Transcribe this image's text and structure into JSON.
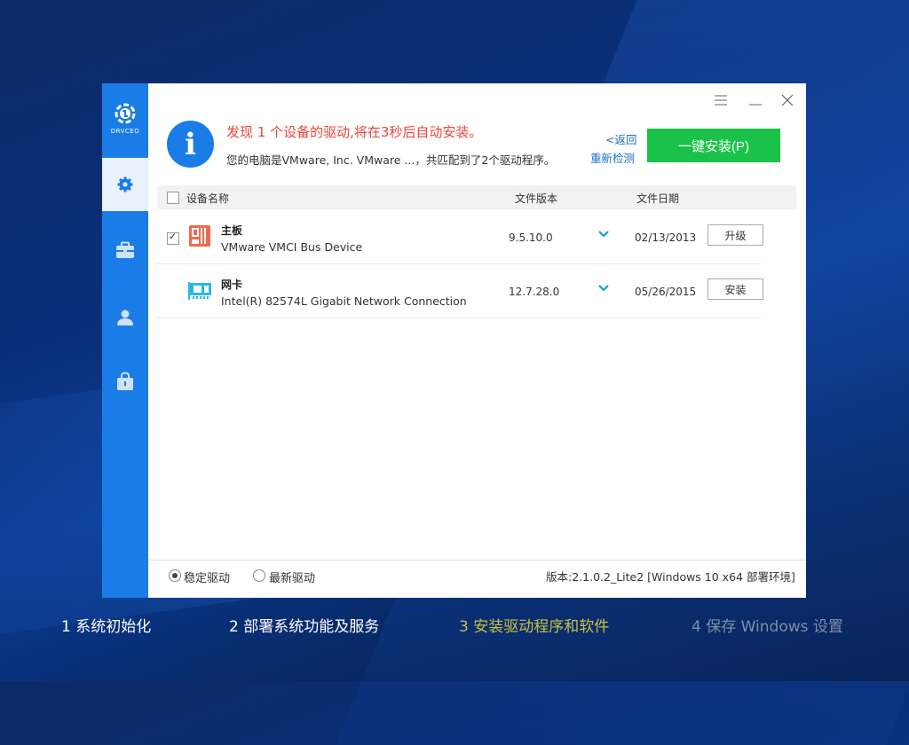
{
  "app": {
    "logo_text": "DRVCEO"
  },
  "sidebar": {
    "items": [
      {
        "icon": "gear-icon",
        "active": true
      },
      {
        "icon": "toolbox-icon",
        "active": false
      },
      {
        "icon": "user-icon",
        "active": false
      },
      {
        "icon": "bag-icon",
        "active": false
      }
    ]
  },
  "window_controls": {
    "menu": "☰",
    "minimize": "—",
    "close": "✕"
  },
  "header": {
    "headline": "发现 1 个设备的驱动,将在3秒后自动安装。",
    "subline": "您的电脑是VMware, Inc. VMware ...，共匹配到了2个驱动程序。",
    "back_link": "<返回",
    "rescan_link": "重新检测",
    "install_all": "一键安装(P)"
  },
  "table": {
    "col_name": "设备名称",
    "col_version": "文件版本",
    "col_date": "文件日期",
    "rows": [
      {
        "name": "主板",
        "desc": "VMware VMCI Bus Device",
        "version": "9.5.10.0",
        "date": "02/13/2013",
        "action": "升级",
        "checked": true
      },
      {
        "name": "网卡",
        "desc": "Intel(R) 82574L Gigabit Network Connection",
        "version": "12.7.28.0",
        "date": "05/26/2015",
        "action": "安装",
        "checked": false
      }
    ]
  },
  "footer": {
    "stable_label": "稳定驱动",
    "latest_label": "最新驱动",
    "version_text": "版本:2.1.0.2_Lite2 [Windows 10 x64 部署环境]"
  },
  "steps": [
    {
      "label": "1  系统初始化",
      "color": "#ffffff"
    },
    {
      "label": "2  部署系统功能及服务",
      "color": "#ffffff"
    },
    {
      "label": "3  安装驱动程序和软件",
      "color": "#c8c040"
    },
    {
      "label": "4  保存 Windows 设置",
      "color": "#7f8fa8"
    }
  ]
}
